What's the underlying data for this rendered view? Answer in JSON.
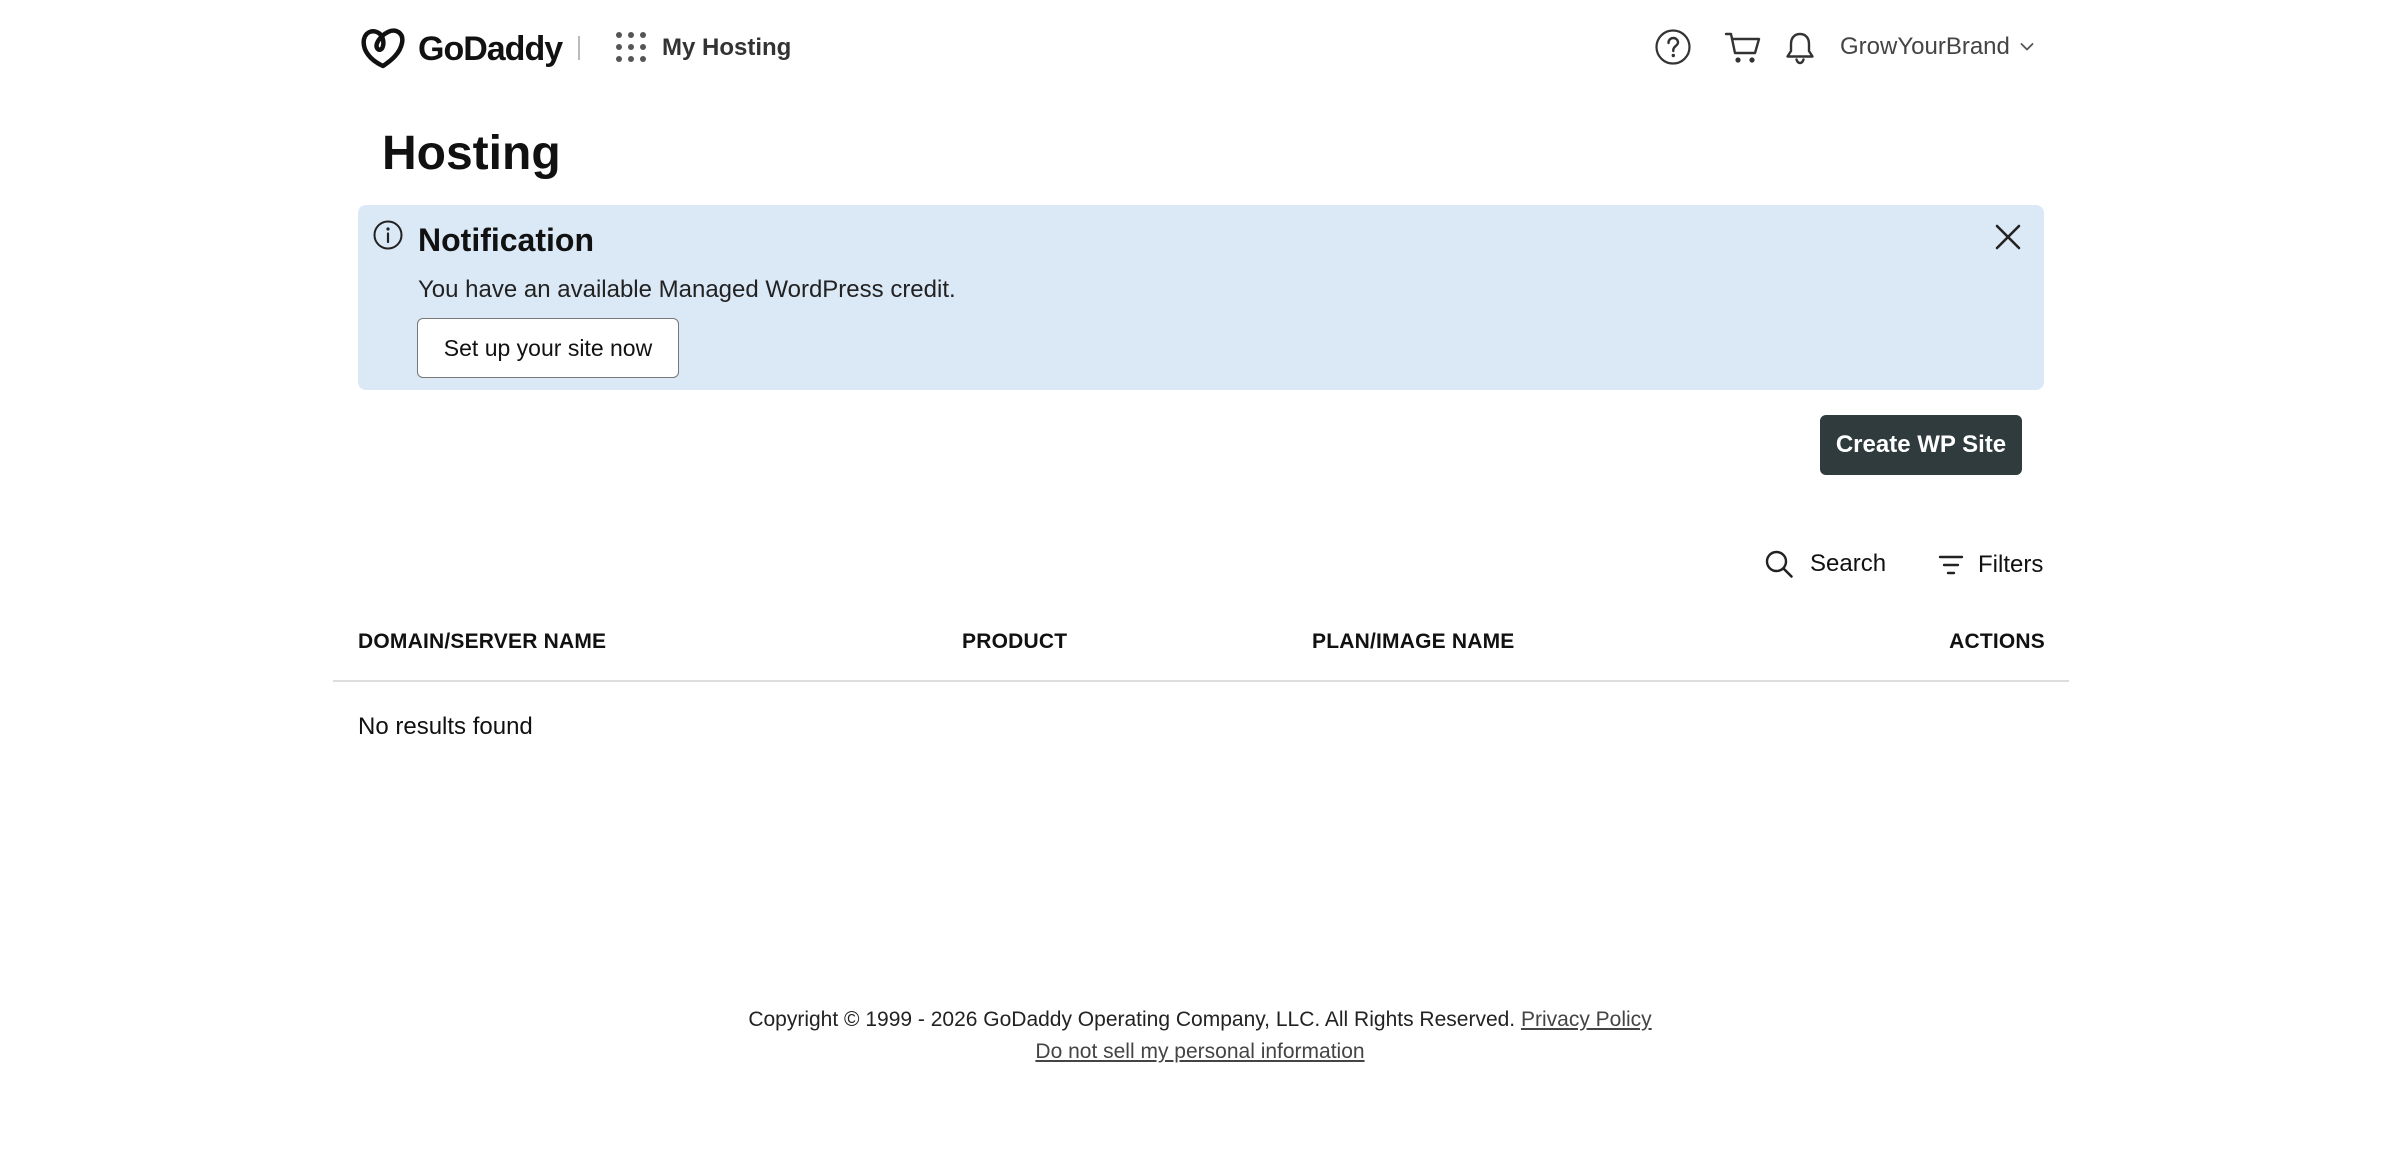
{
  "header": {
    "brand": "GoDaddy",
    "product_name": "My Hosting",
    "account_name": "GrowYourBrand"
  },
  "page": {
    "title": "Hosting"
  },
  "notification": {
    "title": "Notification",
    "message": "You have an available Managed WordPress credit.",
    "button_label": "Set up your site now"
  },
  "actions": {
    "create_label": "Create WP Site"
  },
  "toolbar": {
    "search_label": "Search",
    "filters_label": "Filters"
  },
  "table": {
    "columns": [
      "DOMAIN/SERVER NAME",
      "PRODUCT",
      "PLAN/IMAGE NAME",
      "ACTIONS"
    ],
    "empty_message": "No results found"
  },
  "footer": {
    "copyright": "Copyright © 1999 - 2026 GoDaddy Operating Company, LLC. All Rights Reserved.",
    "privacy_link": "Privacy Policy",
    "do_not_sell_link": "Do not sell my personal information"
  },
  "colors": {
    "notification_bg": "#dbe8f6",
    "primary_button": "#2f3b3c"
  },
  "icons": {
    "logo": "godaddy-logo-icon",
    "apps": "apps-grid-icon",
    "help": "help-circle-icon",
    "cart": "cart-icon",
    "bell": "bell-icon",
    "account": "chevron-down-icon",
    "info": "info-circle-icon",
    "close": "close-icon",
    "search": "search-icon",
    "filters": "filter-icon"
  }
}
